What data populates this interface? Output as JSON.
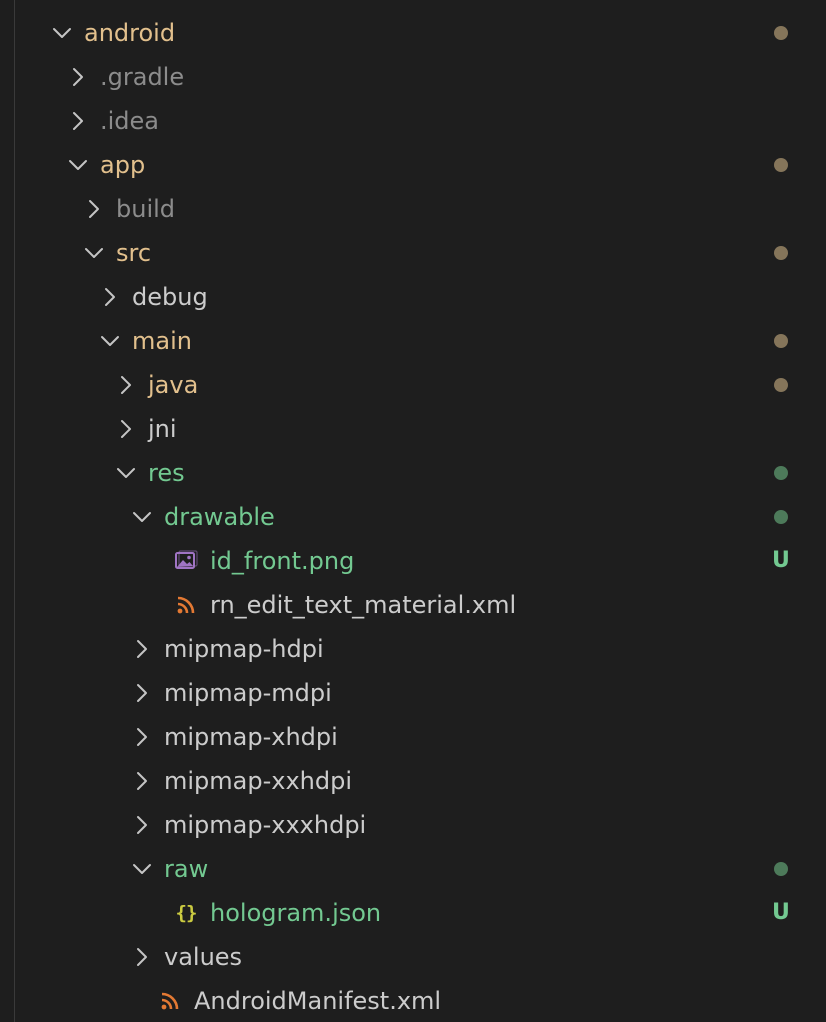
{
  "colors": {
    "background": "#1e1e1e",
    "text_default": "#cccccc",
    "text_ignored": "#8c8c8c",
    "text_modified": "#e2c08d",
    "text_untracked": "#73c991",
    "dot_modified": "#85755a",
    "dot_untracked": "#4d7a5a",
    "chevron": "#c5c5c5",
    "icon_image": "#a074c4",
    "icon_rss": "#e37933",
    "icon_json": "#cbcb41"
  },
  "tree": [
    {
      "label": "android",
      "depth": 0,
      "kind": "folder",
      "expanded": true,
      "status": "modified",
      "marker": "dot"
    },
    {
      "label": ".gradle",
      "depth": 1,
      "kind": "folder",
      "expanded": false,
      "status": "ignored",
      "marker": ""
    },
    {
      "label": ".idea",
      "depth": 1,
      "kind": "folder",
      "expanded": false,
      "status": "ignored",
      "marker": ""
    },
    {
      "label": "app",
      "depth": 1,
      "kind": "folder",
      "expanded": true,
      "status": "modified",
      "marker": "dot"
    },
    {
      "label": "build",
      "depth": 2,
      "kind": "folder",
      "expanded": false,
      "status": "ignored",
      "marker": ""
    },
    {
      "label": "src",
      "depth": 2,
      "kind": "folder",
      "expanded": true,
      "status": "modified",
      "marker": "dot"
    },
    {
      "label": "debug",
      "depth": 3,
      "kind": "folder",
      "expanded": false,
      "status": "default",
      "marker": ""
    },
    {
      "label": "main",
      "depth": 3,
      "kind": "folder",
      "expanded": true,
      "status": "modified",
      "marker": "dot"
    },
    {
      "label": "java",
      "depth": 4,
      "kind": "folder",
      "expanded": false,
      "status": "modified",
      "marker": "dot"
    },
    {
      "label": "jni",
      "depth": 4,
      "kind": "folder",
      "expanded": false,
      "status": "default",
      "marker": ""
    },
    {
      "label": "res",
      "depth": 4,
      "kind": "folder",
      "expanded": true,
      "status": "untracked",
      "marker": "dot"
    },
    {
      "label": "drawable",
      "depth": 5,
      "kind": "folder",
      "expanded": true,
      "status": "untracked",
      "marker": "dot"
    },
    {
      "label": "id_front.png",
      "depth": 5,
      "kind": "file",
      "icon": "image-file-icon",
      "status": "untracked",
      "marker": "U"
    },
    {
      "label": "rn_edit_text_material.xml",
      "depth": 5,
      "kind": "file",
      "icon": "rss-xml-file-icon",
      "status": "default",
      "marker": ""
    },
    {
      "label": "mipmap-hdpi",
      "depth": 5,
      "kind": "folder",
      "expanded": false,
      "status": "default",
      "marker": ""
    },
    {
      "label": "mipmap-mdpi",
      "depth": 5,
      "kind": "folder",
      "expanded": false,
      "status": "default",
      "marker": ""
    },
    {
      "label": "mipmap-xhdpi",
      "depth": 5,
      "kind": "folder",
      "expanded": false,
      "status": "default",
      "marker": ""
    },
    {
      "label": "mipmap-xxhdpi",
      "depth": 5,
      "kind": "folder",
      "expanded": false,
      "status": "default",
      "marker": ""
    },
    {
      "label": "mipmap-xxxhdpi",
      "depth": 5,
      "kind": "folder",
      "expanded": false,
      "status": "default",
      "marker": ""
    },
    {
      "label": "raw",
      "depth": 5,
      "kind": "folder",
      "expanded": true,
      "status": "untracked",
      "marker": "dot"
    },
    {
      "label": "hologram.json",
      "depth": 5,
      "kind": "file",
      "icon": "json-file-icon",
      "status": "untracked",
      "marker": "U"
    },
    {
      "label": "values",
      "depth": 5,
      "kind": "folder",
      "expanded": false,
      "status": "default",
      "marker": ""
    },
    {
      "label": "AndroidManifest.xml",
      "depth": 4,
      "kind": "file",
      "icon": "rss-xml-file-icon",
      "status": "default",
      "marker": ""
    }
  ]
}
